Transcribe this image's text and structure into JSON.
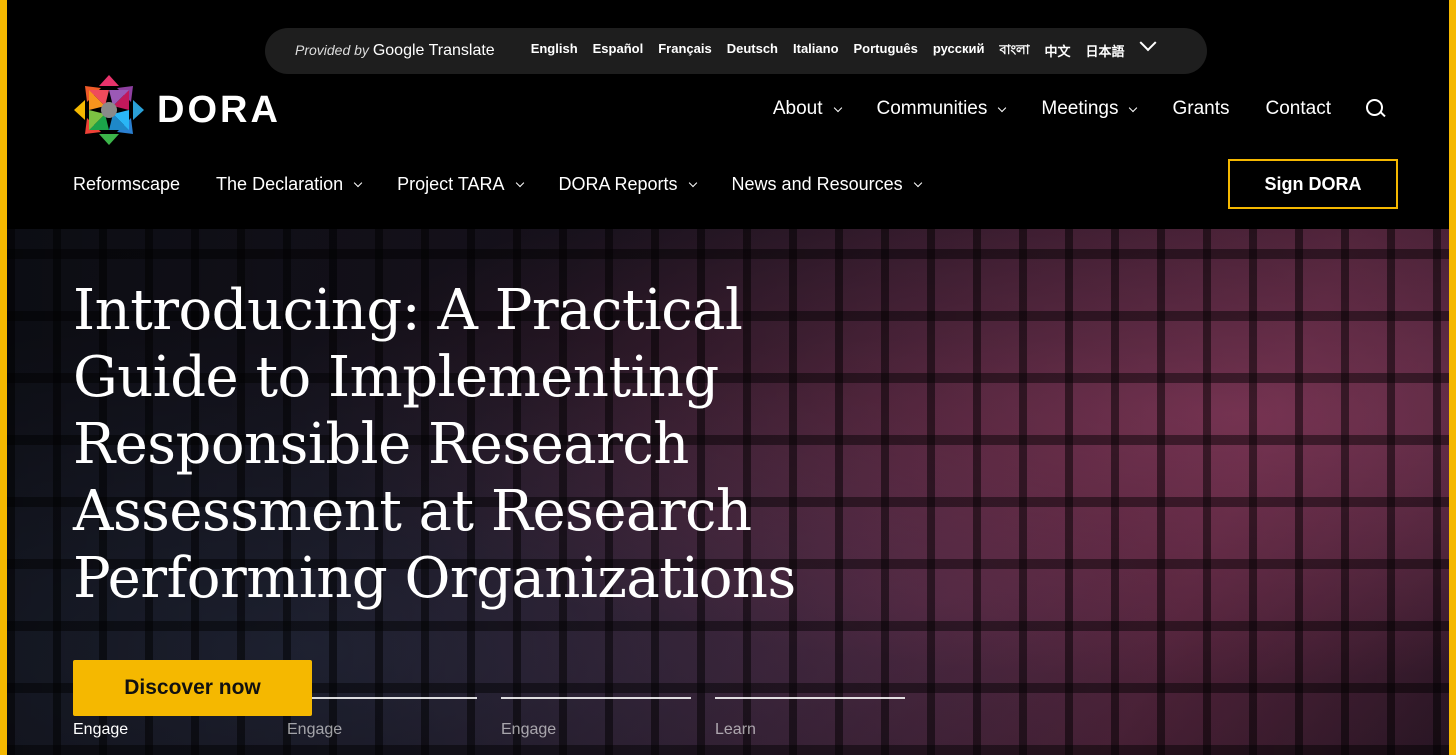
{
  "translate": {
    "provided_by": "Provided by",
    "service": "Google Translate",
    "languages": [
      "English",
      "Español",
      "Français",
      "Deutsch",
      "Italiano",
      "Português",
      "русский",
      "বাংলা",
      "中文",
      "日本語"
    ]
  },
  "logo": {
    "text": "DORA"
  },
  "main_nav": {
    "items": [
      {
        "label": "About",
        "dropdown": true
      },
      {
        "label": "Communities",
        "dropdown": true
      },
      {
        "label": "Meetings",
        "dropdown": true
      },
      {
        "label": "Grants",
        "dropdown": false
      },
      {
        "label": "Contact",
        "dropdown": false
      }
    ]
  },
  "sub_nav": {
    "items": [
      {
        "label": "Reformscape",
        "dropdown": false
      },
      {
        "label": "The Declaration",
        "dropdown": true
      },
      {
        "label": "Project TARA",
        "dropdown": true
      },
      {
        "label": "DORA Reports",
        "dropdown": true
      },
      {
        "label": "News and Resources",
        "dropdown": true
      }
    ]
  },
  "sign_button": "Sign DORA",
  "hero": {
    "title": "Introducing: A Practical Guide to Implementing Responsible Research Assessment at Research Performing Organizations",
    "cta": "Discover now",
    "slides": [
      "Engage",
      "Engage",
      "Engage",
      "Learn"
    ]
  },
  "colors": {
    "accent": "#f5b800",
    "background": "#000000"
  }
}
